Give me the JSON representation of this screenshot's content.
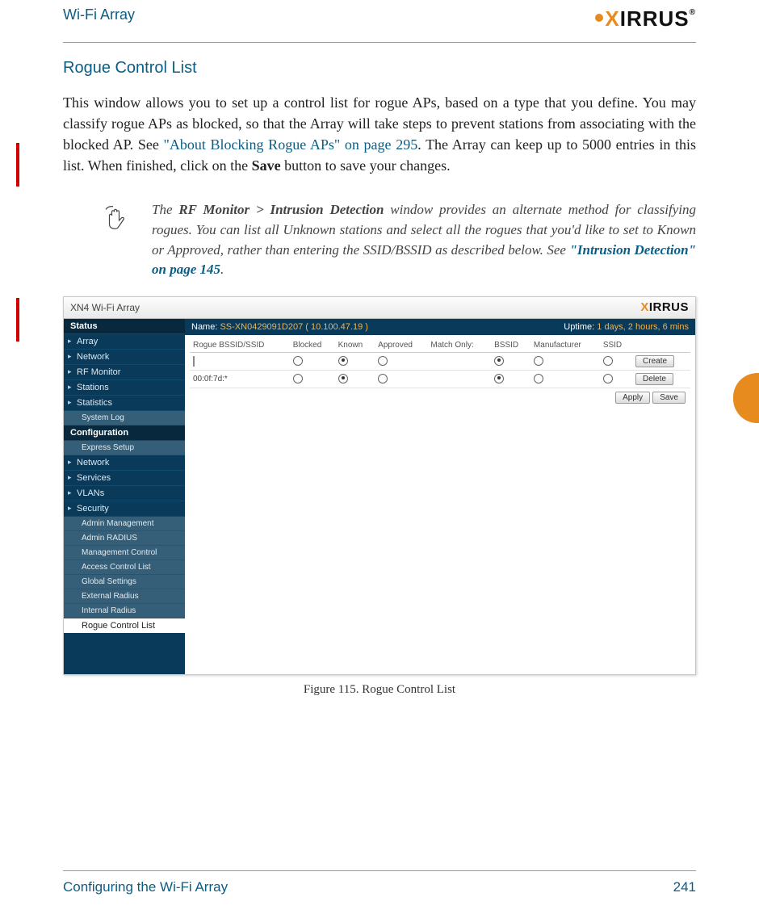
{
  "header": {
    "product_line": "Wi-Fi Array",
    "logo_text": "XIRRUS",
    "logo_tm": "®"
  },
  "section": {
    "heading": "Rogue Control List",
    "para_1a": "This window allows you to set up a control list for rogue APs, based on a type that you define. You may classify rogue APs as blocked, so that the Array will take steps to prevent stations from associating with the blocked AP. See ",
    "para_link1": "\"About Blocking Rogue APs\" on page 295",
    "para_1b": ". The Array can keep up to 5000 entries in this list. When finished, click on the ",
    "para_bold": "Save",
    "para_1c": " button to save your changes."
  },
  "note": {
    "lead_a": "The ",
    "bold_a": "RF Monitor > Intrusion Detection",
    "mid": " window provides an alternate method for classifying rogues. You can list all Unknown stations and select all the rogues that you'd like to set to Known or Approved, rather than entering the SSID/BSSID as described below. See ",
    "link": "\"Intrusion Detection\" on page 145",
    "tail": "."
  },
  "screenshot": {
    "titlebar": "XN4 Wi-Fi Array",
    "logo": "XIRRUS",
    "name_label": "Name:",
    "name_value": "SS-XN0429091D207   ( 10.100.47.19 )",
    "uptime_label": "Uptime:",
    "uptime_value": "1 days, 2 hours, 6 mins",
    "nav": {
      "status_head": "Status",
      "status_items": [
        "Array",
        "Network",
        "RF Monitor",
        "Stations",
        "Statistics"
      ],
      "status_sub": "System Log",
      "config_head": "Configuration",
      "config_sub_top": "Express Setup",
      "config_items": [
        "Network",
        "Services",
        "VLANs",
        "Security"
      ],
      "security_subs": [
        "Admin Management",
        "Admin RADIUS",
        "Management Control",
        "Access Control List",
        "Global Settings",
        "External Radius",
        "Internal Radius"
      ],
      "current": "Rogue Control List"
    },
    "columns": [
      "Rogue BSSID/SSID",
      "Blocked",
      "Known",
      "Approved",
      "Match Only:",
      "BSSID",
      "Manufacturer",
      "SSID",
      ""
    ],
    "row_input_value": "",
    "row2_bssid": "00:0f:7d:*",
    "row1_selected": {
      "blocked": false,
      "known": true,
      "approved": false,
      "bssid": true,
      "manufacturer": false,
      "ssid": false
    },
    "row2_selected": {
      "blocked": false,
      "known": true,
      "approved": false,
      "bssid": true,
      "manufacturer": false,
      "ssid": false
    },
    "btn_create": "Create",
    "btn_delete": "Delete",
    "btn_apply": "Apply",
    "btn_save": "Save"
  },
  "figure_caption": "Figure 115. Rogue Control List",
  "footer": {
    "section": "Configuring the Wi-Fi Array",
    "page": "241"
  }
}
